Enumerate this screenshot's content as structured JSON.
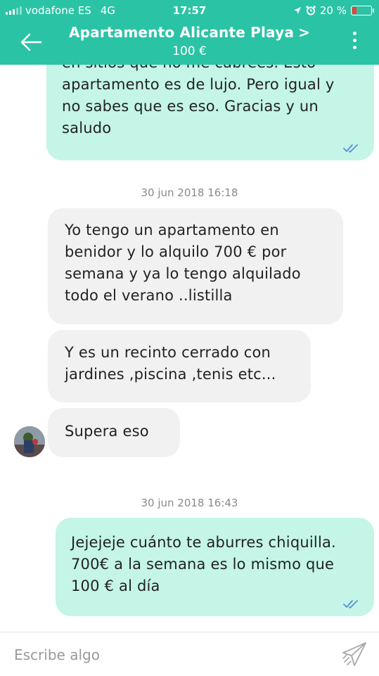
{
  "status_bar": {
    "carrier": "vodafone ES",
    "network": "4G",
    "time": "17:57",
    "battery_percent_label": "20 %",
    "battery_level": 0.2,
    "colors": {
      "bar": "#2bc3a6",
      "battery_low": "#ff3b30"
    }
  },
  "header": {
    "title": "Apartamento Alicante Playa",
    "title_chevron": ">",
    "price": "100 €",
    "back_icon": "arrow-left-icon",
    "menu_icon": "more-vertical-icon"
  },
  "messages": [
    {
      "direction": "outgoing",
      "lines": [
        "en sitios que no me cabrees. Esto",
        "apartamento es de lujo. Pero igual y",
        "no sabes que es eso. Gracias y un",
        "saludo"
      ],
      "read": true
    },
    {
      "type": "timestamp",
      "text": "30 jun 2018 16:18"
    },
    {
      "direction": "incoming",
      "lines": [
        "Yo tengo un apartamento en",
        "benidor y lo alquilo 700 € por",
        "semana y ya lo tengo alquilado",
        "todo el verano ..listilla"
      ]
    },
    {
      "direction": "incoming",
      "lines": [
        "Y es un recinto cerrado con",
        "jardines ,piscina ,tenis etc..."
      ]
    },
    {
      "direction": "incoming",
      "lines": [
        "Supera eso"
      ]
    },
    {
      "type": "timestamp",
      "text": "30 jun 2018 16:43"
    },
    {
      "direction": "outgoing",
      "lines": [
        "Jejejeje cuánto te aburres chiquilla.",
        "700€ a la semana es lo mismo que",
        "100 € al día"
      ],
      "read": true
    }
  ],
  "composer": {
    "placeholder": "Escribe algo",
    "value": "",
    "send_icon": "paper-plane-icon"
  },
  "colors": {
    "accent": "#2bc3a6",
    "outgoing_bubble": "#c4f5e6",
    "incoming_bubble": "#f1f1f1",
    "read_ticks": "#5a8fd6",
    "timestamp_text": "#8a8a8a"
  }
}
